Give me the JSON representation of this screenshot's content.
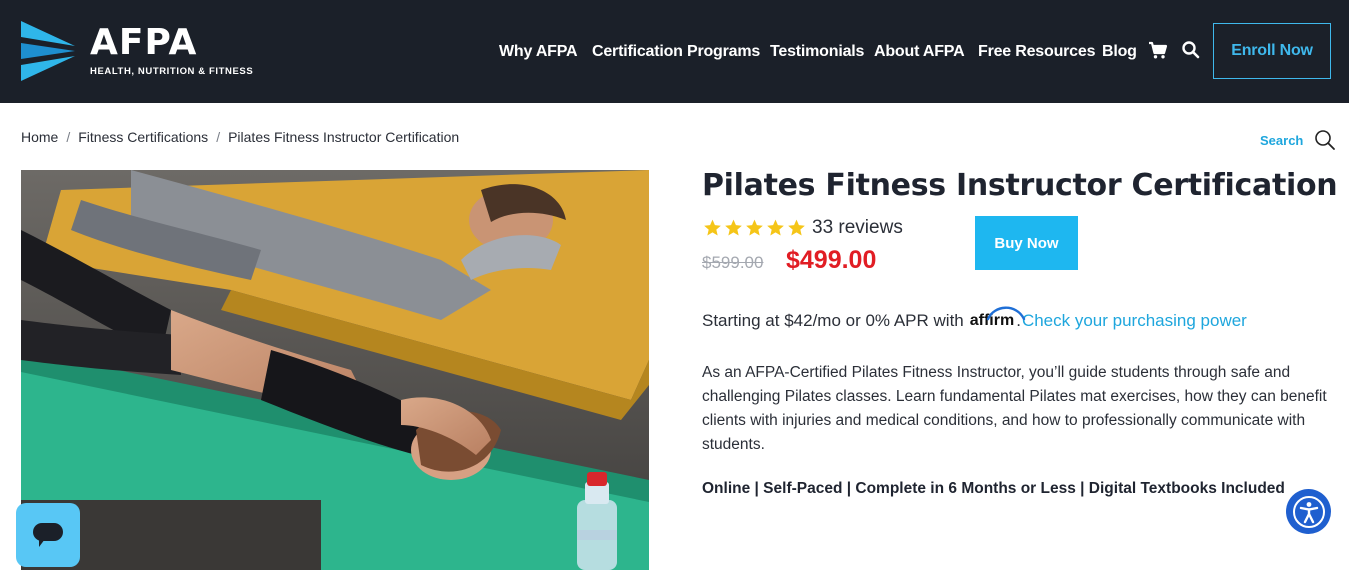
{
  "header": {
    "brand": "AFPA",
    "tagline": "HEALTH, NUTRITION & FITNESS",
    "nav": [
      "Why AFPA",
      "Certification Programs",
      "Testimonials",
      "About AFPA",
      "Free Resources",
      "Blog"
    ],
    "cart_icon": "cart-icon",
    "search_icon": "search-icon",
    "enroll_label": "Enroll Now"
  },
  "breadcrumb": [
    "Home",
    "Fitness Certifications",
    "Pilates Fitness Instructor Certification"
  ],
  "search": {
    "label": "Search",
    "icon": "magnifier-icon"
  },
  "product": {
    "title": "Pilates Fitness Instructor Certification",
    "rating": 5,
    "reviews": "33 reviews",
    "price_old": "$599.00",
    "price_new": "$499.00",
    "buy_label": "Buy Now",
    "financing_text": "Starting at $42/mo or 0% APR with",
    "affirm_brand": "affirm",
    "financing_link": "Check your purchasing power",
    "description": "As an AFPA-Certified Pilates Fitness Instructor, you’ll guide students through safe and challenging Pilates classes. Learn fundamental Pilates mat exercises, how they can benefit clients with injuries and medical conditions, and how to professionally communicate with students.",
    "features": "Online | Self-Paced | Complete in 6 Months or Less | Digital Textbooks Included"
  },
  "widgets": {
    "accessibility_icon": "accessibility-icon",
    "chat_icon": "chat-icon"
  },
  "colors": {
    "header_bg": "#1b2029",
    "accent": "#1eb7f0",
    "link": "#1ea6dd",
    "sale_price": "#e11d24",
    "star": "#f5c518"
  }
}
